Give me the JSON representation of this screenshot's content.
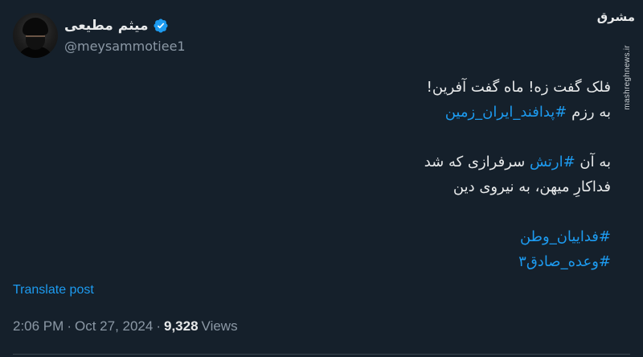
{
  "user": {
    "display_name": "میثم مطیعی",
    "handle": "@meysammotiee1"
  },
  "watermark": {
    "logo_text": "مشرق",
    "site_text": "mashreghnews.ir"
  },
  "tweet": {
    "line1": "فلک گفت زه! ماه گفت آفرین!",
    "line2_text": "به رزم ",
    "line2_tag": "#پدافند_ایران_زمین",
    "line3_pre": "به آن ",
    "line3_tag": "#ارتش",
    "line3_post": " سرفرازی که شد",
    "line4": "فداکارِ میهن، به نیروی دین",
    "tag1": "#فداییان_وطن",
    "tag2": "#وعده_صادق۳"
  },
  "translate_label": "Translate post",
  "meta": {
    "time": "2:06 PM",
    "sep1": "·",
    "date": "Oct 27, 2024",
    "sep2": "·",
    "views_count": "9,328",
    "views_label": "Views"
  },
  "colors": {
    "background": "#15202b",
    "link": "#1d9bf0",
    "secondary_text": "#8b98a5"
  },
  "icons": [
    "verified-badge-icon",
    "avatar"
  ]
}
